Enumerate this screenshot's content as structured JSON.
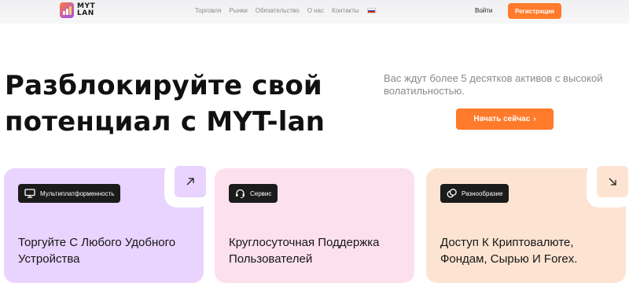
{
  "brand": {
    "line1": "MYT",
    "line2": "LAN"
  },
  "nav": {
    "items": [
      "Торговля",
      "Рынки",
      "Обязательство",
      "О нас",
      "Контакты"
    ],
    "language": "ru"
  },
  "header": {
    "login_label": "Войти",
    "register_label": "Регистрация"
  },
  "hero": {
    "title_line1": "Разблокируйте свой",
    "title_line2": "потенциал с MYT-lan",
    "subtitle": "Вас ждут более 5 десятков активов с высокой волатильностью.",
    "cta_label": "Начать сейчас",
    "cta_arrow": "›"
  },
  "cards": [
    {
      "tag": "Мультиплатформенность",
      "text": "Торгуйте С Любого Удобного Устройства",
      "icon": "monitor-icon",
      "arrow": "↗"
    },
    {
      "tag": "Сервис",
      "text": "Круглосуточная Поддержка Пользователей",
      "icon": "headset-icon"
    },
    {
      "tag": "Разнообразие",
      "text": "Доступ К Криптовалюте, Фондам, Сырью И Forex.",
      "icon": "coins-icon",
      "arrow": "↘"
    }
  ],
  "colors": {
    "accent": "#ff7a2a",
    "card1": "#e9d3ff",
    "card2": "#fde0ee",
    "card3": "#fde4d2",
    "tag_bg": "#1b1b1b"
  }
}
